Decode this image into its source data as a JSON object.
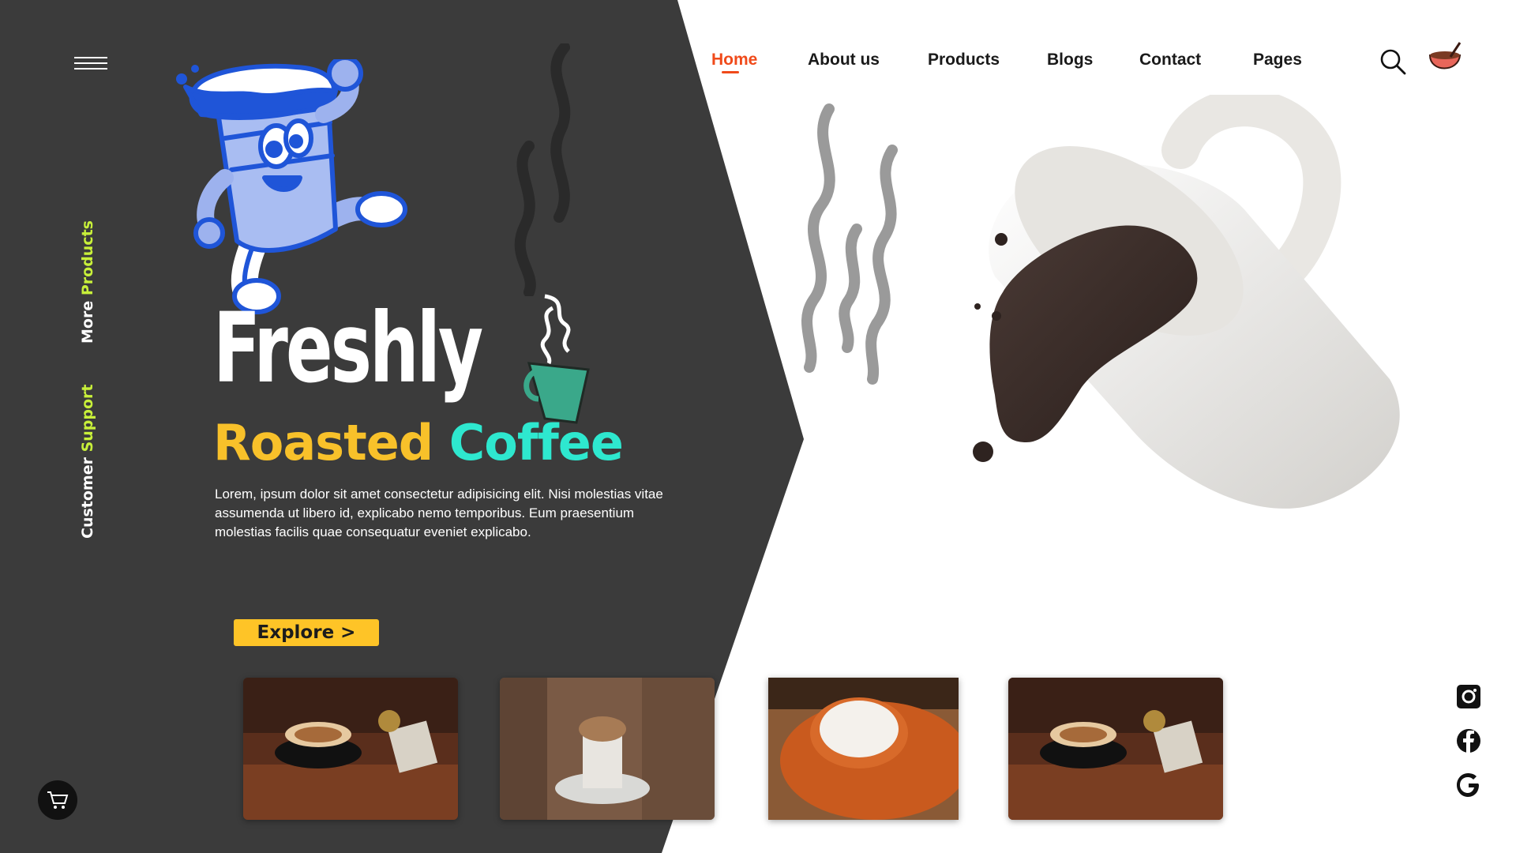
{
  "nav": {
    "items": [
      {
        "label": "Home",
        "active": true
      },
      {
        "label": "About us",
        "active": false
      },
      {
        "label": "Products",
        "active": false
      },
      {
        "label": "Blogs",
        "active": false
      },
      {
        "label": "Contact",
        "active": false
      },
      {
        "label": "Pages",
        "active": false
      }
    ],
    "search_icon": "search-icon",
    "cup_icon": "coffee-cup-icon"
  },
  "side": {
    "menu_icon": "hamburger-menu-icon",
    "more_products": {
      "part1": "More ",
      "part2": "Products"
    },
    "customer_support": {
      "part1": "Customer ",
      "part2": "Support"
    },
    "cart_icon": "shopping-cart-icon"
  },
  "hero": {
    "title": "Freshly",
    "subtitle_word1": "Roasted",
    "subtitle_word2": "Coffee",
    "description": "Lorem, ipsum dolor sit amet consectetur adipisicing elit. Nisi molestias vitae assumenda ut libero id, explicabo nemo temporibus. Eum praesentium molestias facilis quae consequatur eveniet explicabo.",
    "button_label": "Explore >"
  },
  "social": [
    "instagram-icon",
    "facebook-icon",
    "google-icon"
  ],
  "colors": {
    "dark_panel": "#3b3b3b",
    "accent_nav": "#f04a1a",
    "yellow": "#fec427",
    "title_yellow": "#f8c12a",
    "title_teal": "#2ee8cf",
    "side_accent": "#c8f03a",
    "mascot_blue": "#1f55d8"
  }
}
